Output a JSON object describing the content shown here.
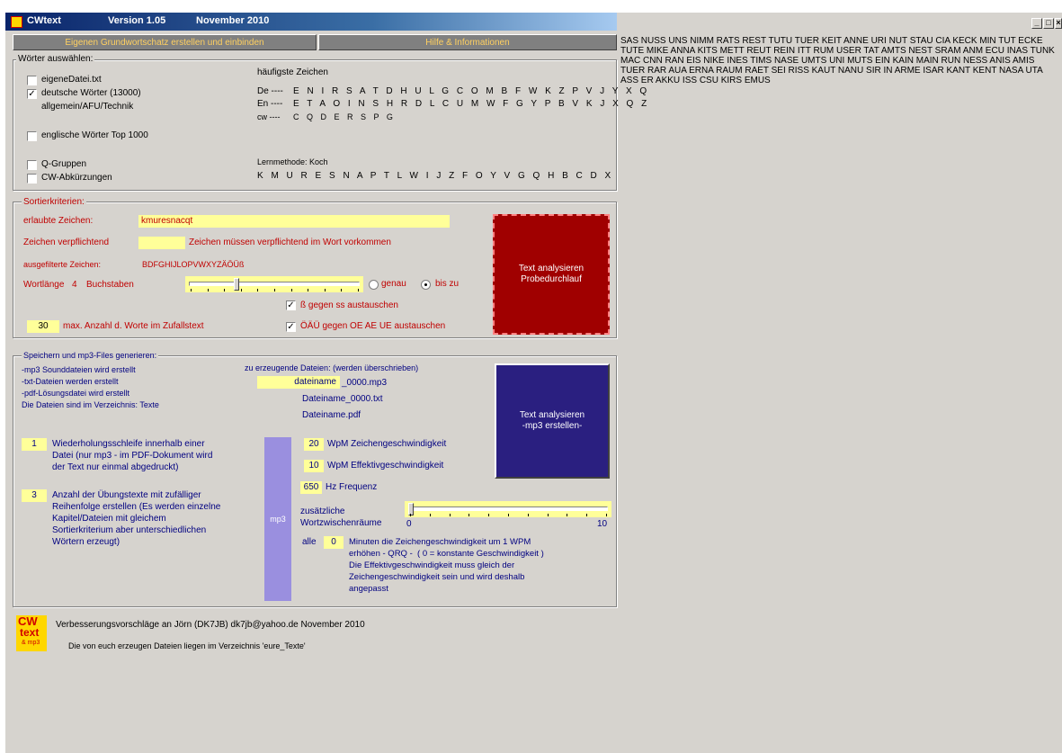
{
  "window": {
    "title": "CWtext",
    "version": "Version 1.05",
    "date": "November 2010",
    "controls": [
      "_",
      "□",
      "×"
    ]
  },
  "toolbar": {
    "create_button": "Eigenen Grundwortschatz erstellen und einbinden",
    "help_button": "Hilfe & Informationen"
  },
  "words_group": {
    "legend": "Wörter auswählen:",
    "own_file": {
      "label": "eigeneDatei.txt",
      "checked": false
    },
    "german": {
      "label": "deutsche Wörter (13000)",
      "checked": true
    },
    "german_sub": "allgemein/AFU/Technik",
    "english": {
      "label": "englische Wörter Top 1000",
      "checked": false
    },
    "q_groups": {
      "label": "Q-Gruppen",
      "checked": false
    },
    "cw_abbrev": {
      "label": "CW-Abkürzungen",
      "checked": false
    },
    "frequent_title": "häufigste Zeichen",
    "freq_de_label": "De ----",
    "freq_de": "E N I R S A T D H U L G C O M B F W K Z P V J Y X Q",
    "freq_en_label": "En ----",
    "freq_en": "E T A O I N S H R D L C U M W F G Y P B V K J X Q Z",
    "freq_cw_label": "cw ----",
    "freq_cw": "C Q D E R S P G",
    "learn_title": "Lernmethode: Koch",
    "learn_seq": "K M U R E S N A P T L W I J Z F O Y V G Q H B C D X"
  },
  "sort_group": {
    "legend": "Sortierkriterien:",
    "allowed_label": "erlaubte Zeichen:",
    "allowed_value": "kmuresnacqt",
    "mandatory_label": "Zeichen verpflichtend",
    "mandatory_value": "",
    "mandatory_hint": "Zeichen müssen verpflichtend im Wort vorkommen",
    "excluded_label": "ausgefilterte Zeichen:",
    "excluded_value": "BDFGHIJLOPVWXYZÄÖÜß",
    "length_label": "Wortlänge",
    "length_value": "4",
    "length_unit": "Buchstaben",
    "length_level": 0.27,
    "radio_exact": {
      "label": "genau",
      "selected": false
    },
    "radio_upto": {
      "label": "bis zu",
      "selected": true
    },
    "ss_checkbox": {
      "label": "ß gegen ss austauschen",
      "checked": true
    },
    "oau_checkbox": {
      "label": "ÖÄÜ gegen OE AE UE austauschen",
      "checked": true
    },
    "max_words_value": "30",
    "max_words_label": "max. Anzahl d. Worte im Zufallstext",
    "analyze_button": "Text analysieren\nProbedurchlauf"
  },
  "save_group": {
    "legend": "Speichern und mp3-Files generieren:",
    "info_lines": [
      "-mp3 Sounddateien wird erstellt",
      "-txt-Dateien werden erstellt",
      "-pdf-Lösungsdatei wird erstellt",
      "Die Dateien sind im Verzeichnis: Texte"
    ],
    "files_title": "zu erzeugende Dateien: (werden überschrieben)",
    "filename_value": "dateiname",
    "filename_suffix": "_0000.mp3",
    "file_txt": "Dateiname_0000.txt",
    "file_pdf": "Dateiname.pdf",
    "repeat_value": "1",
    "repeat_text": "Wiederholungsschleife innerhalb einer\nDatei (nur mp3 - im PDF-Dokument wird\nder Text nur einmal abgedruckt)",
    "count_value": "3",
    "count_text": "Anzahl der Übungstexte mit zufälliger\nReihenfolge erstellen (Es werden einzelne\nKapitel/Dateien mit gleichem\nSortierkriterium aber unterschiedlichen\nWörtern erzeugt)",
    "mp3_label": "mp3",
    "char_speed_value": "20",
    "char_speed_label": "WpM  Zeichengeschwindigkeit",
    "eff_speed_value": "10",
    "eff_speed_label": "WpM  Effektivgeschwindigkeit",
    "freq_value": "650",
    "freq_label": "Hz Frequenz",
    "spaces_label": "zusätzliche\nWortzwischenräume",
    "spaces_min": "0",
    "spaces_max": "10",
    "spaces_level": 0.0,
    "every_label": "alle",
    "every_value": "0",
    "every_text": "Minuten die Zeichengeschwindigkeit um 1 WPM\nerhöhen - QRQ -  ( 0 = konstante Geschwindigkeit )\nDie Effektivgeschwindigkeit muss gleich der\nZeichengeschwindigkeit sein und wird deshalb\nangepasst",
    "create_button": "Text analysieren\n-mp3 erstellen-"
  },
  "footer": {
    "logo_top": "CW",
    "logo_mid": "text",
    "logo_bot": "& mp3",
    "credits": "Verbesserungsvorschläge an Jörn  (DK7JB)   dk7jb@yahoo.de    November 2010",
    "note": "Die von euch erzeugen Dateien liegen im Verzeichnis 'eure_Texte'"
  },
  "output_text": "SAS NUSS UNS NIMM RATS REST TUTU TUER KEIT ANNE URI NUT STAU CIA KECK MIN TUT ECKE TUTE MIKE ANNA KITS METT REUT REIN ITT RUM USER TAT AMTS NEST SRAM ANM ECU INAS TUNK MAC CNN RAN EIS NIKE INES TIMS NASE UMTS UNI MUTS EIN KAIN MAIN RUN NESS ANIS AMIS TUER RAR AUA ERNA RAUM RAET SEI RISS KAUT NANU SIR IN ARME ISAR KANT KENT NASA UTA ASS ER AKKU ISS CSU KIRS EMUS",
  "colors": {
    "titlebar": "#0a246a",
    "face": "#d6d3ce",
    "yellow_field": "#ffff99",
    "analyze_button": "#a00000",
    "mp3_button": "#2a1f80",
    "mp3_bar": "#9a8fdf",
    "red_text": "#c00000"
  }
}
